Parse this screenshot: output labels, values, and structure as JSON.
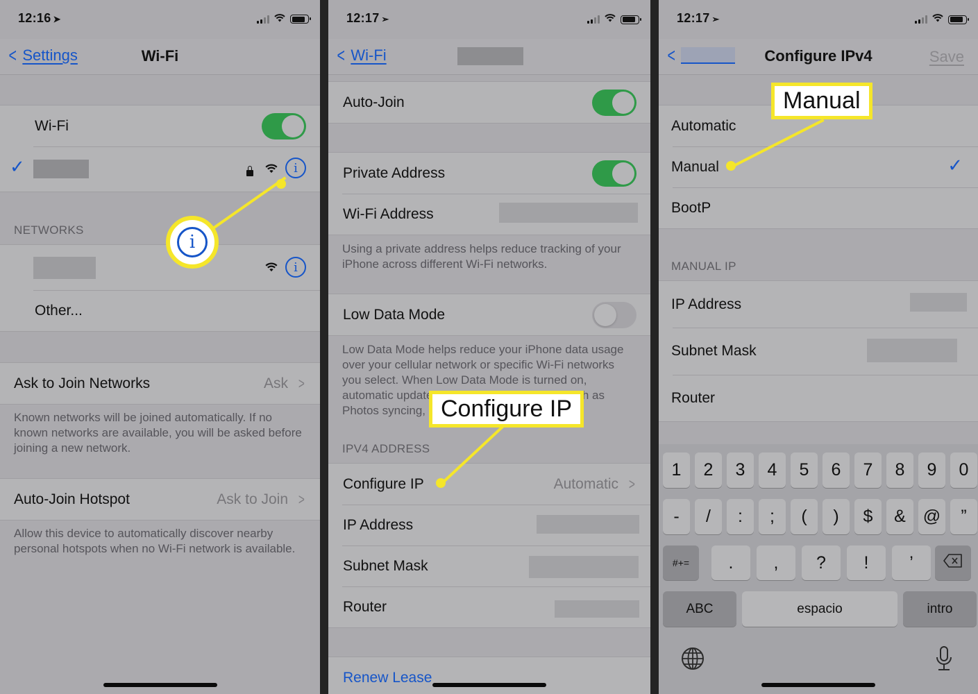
{
  "panels": [
    {
      "status": {
        "time": "12:16",
        "location_icon": "location-arrow-icon",
        "signal_bars": 2,
        "signal_total": 4,
        "wifi_icon": "wifi-icon",
        "battery_icon": "battery-icon"
      },
      "nav": {
        "back_label": "Settings",
        "title": "Wi-Fi"
      },
      "wifi_toggle": {
        "label": "Wi-Fi",
        "on": true
      },
      "connected_network": {
        "name": "[redacted]",
        "checked": true,
        "locked": true
      },
      "networks_header": "NETWORKS",
      "networks": [
        {
          "name": "[redacted]"
        },
        {
          "name": "Other..."
        }
      ],
      "ask_to_join": {
        "label": "Ask to Join Networks",
        "value": "Ask",
        "footer": "Known networks will be joined automatically. If no known networks are available, you will be asked before joining a new network."
      },
      "auto_join_hotspot": {
        "label": "Auto-Join Hotspot",
        "value": "Ask to Join",
        "footer": "Allow this device to automatically discover nearby personal hotspots when no Wi-Fi network is available."
      },
      "callout": {
        "type": "info-icon-highlight",
        "icon": "info-icon"
      }
    },
    {
      "status": {
        "time": "12:17",
        "location_icon": "location-arrow-outline-icon",
        "signal_bars": 2,
        "signal_total": 4
      },
      "nav": {
        "back_label": "Wi-Fi",
        "title": "[redacted]"
      },
      "auto_join": {
        "label": "Auto-Join",
        "on": true
      },
      "private_address": {
        "label": "Private Address",
        "on": true
      },
      "wifi_address": {
        "label": "Wi-Fi Address",
        "value": "[redacted]",
        "footer": "Using a private address helps reduce tracking of your iPhone across different Wi-Fi networks."
      },
      "low_data_mode": {
        "label": "Low Data Mode",
        "on": false,
        "footer": "Low Data Mode helps reduce your iPhone data usage over your cellular network or specific Wi-Fi networks you select. When Low Data Mode is turned on, automatic updates and background tasks, such as Photos syncing, are paused."
      },
      "ipv4_header": "IPV4 ADDRESS",
      "ipv4_rows": [
        {
          "label": "Configure IP",
          "value": "Automatic",
          "chevron": true
        },
        {
          "label": "IP Address",
          "value": "[redacted]"
        },
        {
          "label": "Subnet Mask",
          "value": "[redacted]"
        },
        {
          "label": "Router",
          "value": "[redacted]"
        }
      ],
      "renew_lease": "Renew Lease",
      "callout": {
        "text": "Configure IP"
      }
    },
    {
      "status": {
        "time": "12:17",
        "signal_bars": 2,
        "signal_total": 4
      },
      "nav": {
        "back_label": "[redacted]",
        "title": "Configure IPv4",
        "save_label": "Save"
      },
      "options": [
        {
          "label": "Automatic",
          "selected": false
        },
        {
          "label": "Manual",
          "selected": true
        },
        {
          "label": "BootP",
          "selected": false
        }
      ],
      "manual_header": "MANUAL IP",
      "manual_rows": [
        {
          "label": "IP Address",
          "value": "[redacted]"
        },
        {
          "label": "Subnet Mask",
          "value": "[redacted]"
        },
        {
          "label": "Router",
          "value": ""
        }
      ],
      "keyboard": {
        "row1": [
          "1",
          "2",
          "3",
          "4",
          "5",
          "6",
          "7",
          "8",
          "9",
          "0"
        ],
        "row2": [
          "-",
          "/",
          ":",
          ";",
          "(",
          ")",
          "$",
          "&",
          "@",
          "”"
        ],
        "row3": [
          ".",
          ",",
          "?",
          "!",
          "’"
        ],
        "symbols_key": "#+=",
        "delete_icon": "backspace-icon",
        "abc_key": "ABC",
        "space_key": "espacio",
        "return_key": "intro",
        "globe_icon": "globe-icon",
        "mic_icon": "microphone-icon"
      },
      "callout": {
        "text": "Manual"
      }
    }
  ],
  "colors": {
    "accent_blue": "#1655c8",
    "toggle_green": "#2f9a48",
    "callout_yellow": "#f5e62a"
  }
}
